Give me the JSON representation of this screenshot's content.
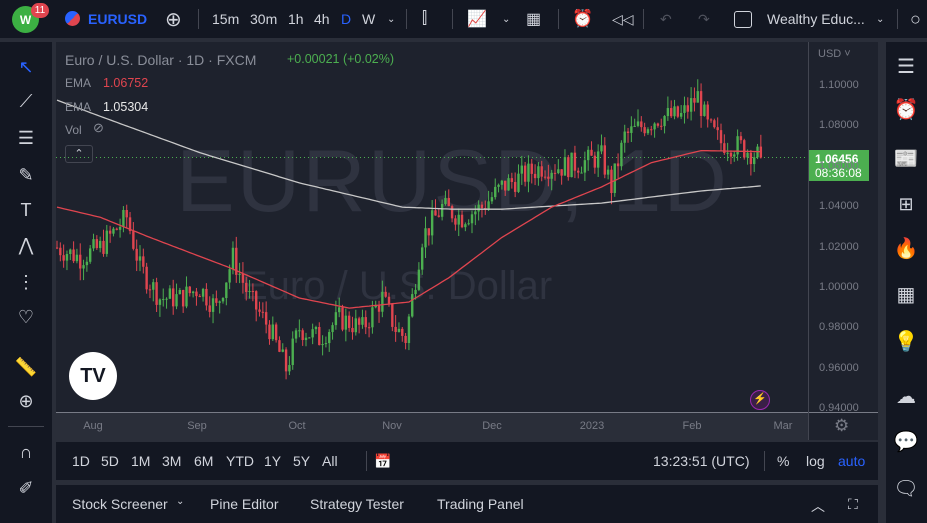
{
  "topbar": {
    "badge": "11",
    "symbol": "EURUSD",
    "intervals": [
      "15m",
      "30m",
      "1h",
      "4h",
      "D",
      "W"
    ],
    "active_interval": "D",
    "layout_name": "Wealthy Educ..."
  },
  "legend": {
    "title": "Euro / U.S. Dollar · 1D · FXCM",
    "change": "+0.00021 (+0.02%)",
    "ema1_label": "EMA",
    "ema1_value": "1.06752",
    "ema2_label": "EMA",
    "ema2_value": "1.05304",
    "vol_label": "Vol"
  },
  "watermark": {
    "line1": "EURUSD, 1D",
    "line2": "Euro / U.S. Dollar"
  },
  "price_axis": {
    "currency": "USD",
    "ticks": [
      "1.10000",
      "1.08000",
      "1.06000",
      "1.04000",
      "1.02000",
      "1.00000",
      "0.98000",
      "0.96000",
      "0.94000"
    ],
    "last_price": "1.06456",
    "countdown": "08:36:08"
  },
  "time_axis": [
    "Aug",
    "Sep",
    "Oct",
    "Nov",
    "Dec",
    "2023",
    "Feb",
    "Mar"
  ],
  "rangebar": {
    "ranges": [
      "1D",
      "5D",
      "1M",
      "3M",
      "6M",
      "YTD",
      "1Y",
      "5Y",
      "All"
    ],
    "clock": "13:23:51 (UTC)",
    "pct": "%",
    "log": "log",
    "auto": "auto"
  },
  "bottom": {
    "tabs": [
      "Stock Screener",
      "Pine Editor",
      "Strategy Tester",
      "Trading Panel"
    ]
  },
  "colors": {
    "up": "#4caf50",
    "down": "#e0454f",
    "ema_fast": "#e0454f",
    "ema_slow": "#c8c8c8",
    "accent": "#2962ff",
    "bg": "#1e222d"
  },
  "chart_data": {
    "type": "candlestick",
    "title": "Euro / U.S. Dollar · 1D · FXCM",
    "ylim": [
      0.94,
      1.1
    ],
    "x_unit": "trading-day index from late Jul 2022",
    "close_anchors": [
      [
        0,
        1.02
      ],
      [
        7,
        1.015
      ],
      [
        13,
        1.02
      ],
      [
        21,
        1.035
      ],
      [
        25,
        1.01
      ],
      [
        31,
        0.995
      ],
      [
        37,
        0.995
      ],
      [
        43,
        1.0
      ],
      [
        48,
        0.99
      ],
      [
        53,
        1.015
      ],
      [
        58,
        0.995
      ],
      [
        64,
        0.98
      ],
      [
        69,
        0.96
      ],
      [
        73,
        0.98
      ],
      [
        79,
        0.975
      ],
      [
        85,
        0.985
      ],
      [
        92,
        0.98
      ],
      [
        98,
        0.995
      ],
      [
        102,
        0.98
      ],
      [
        105,
        0.975
      ],
      [
        110,
        1.025
      ],
      [
        116,
        1.04
      ],
      [
        122,
        1.035
      ],
      [
        128,
        1.04
      ],
      [
        134,
        1.05
      ],
      [
        140,
        1.055
      ],
      [
        146,
        1.06
      ],
      [
        152,
        1.06
      ],
      [
        158,
        1.062
      ],
      [
        164,
        1.065
      ],
      [
        167,
        1.05
      ],
      [
        171,
        1.075
      ],
      [
        176,
        1.08
      ],
      [
        182,
        1.085
      ],
      [
        188,
        1.085
      ],
      [
        193,
        1.095
      ],
      [
        196,
        1.08
      ],
      [
        200,
        1.072
      ],
      [
        206,
        1.07
      ],
      [
        212,
        1.0646
      ]
    ],
    "ema_fast": [
      [
        0,
        1.04
      ],
      [
        13,
        1.035
      ],
      [
        28,
        1.025
      ],
      [
        52,
        1.01
      ],
      [
        73,
        0.995
      ],
      [
        88,
        0.99
      ],
      [
        106,
        0.993
      ],
      [
        118,
        1.005
      ],
      [
        134,
        1.025
      ],
      [
        149,
        1.04
      ],
      [
        164,
        1.05
      ],
      [
        179,
        1.062
      ],
      [
        194,
        1.068
      ],
      [
        212,
        1.0675
      ]
    ],
    "ema_slow": [
      [
        0,
        1.093
      ],
      [
        13,
        1.085
      ],
      [
        43,
        1.067
      ],
      [
        73,
        1.052
      ],
      [
        104,
        1.04
      ],
      [
        119,
        1.039
      ],
      [
        134,
        1.039
      ],
      [
        164,
        1.042
      ],
      [
        194,
        1.048
      ],
      [
        212,
        1.0505
      ]
    ]
  }
}
